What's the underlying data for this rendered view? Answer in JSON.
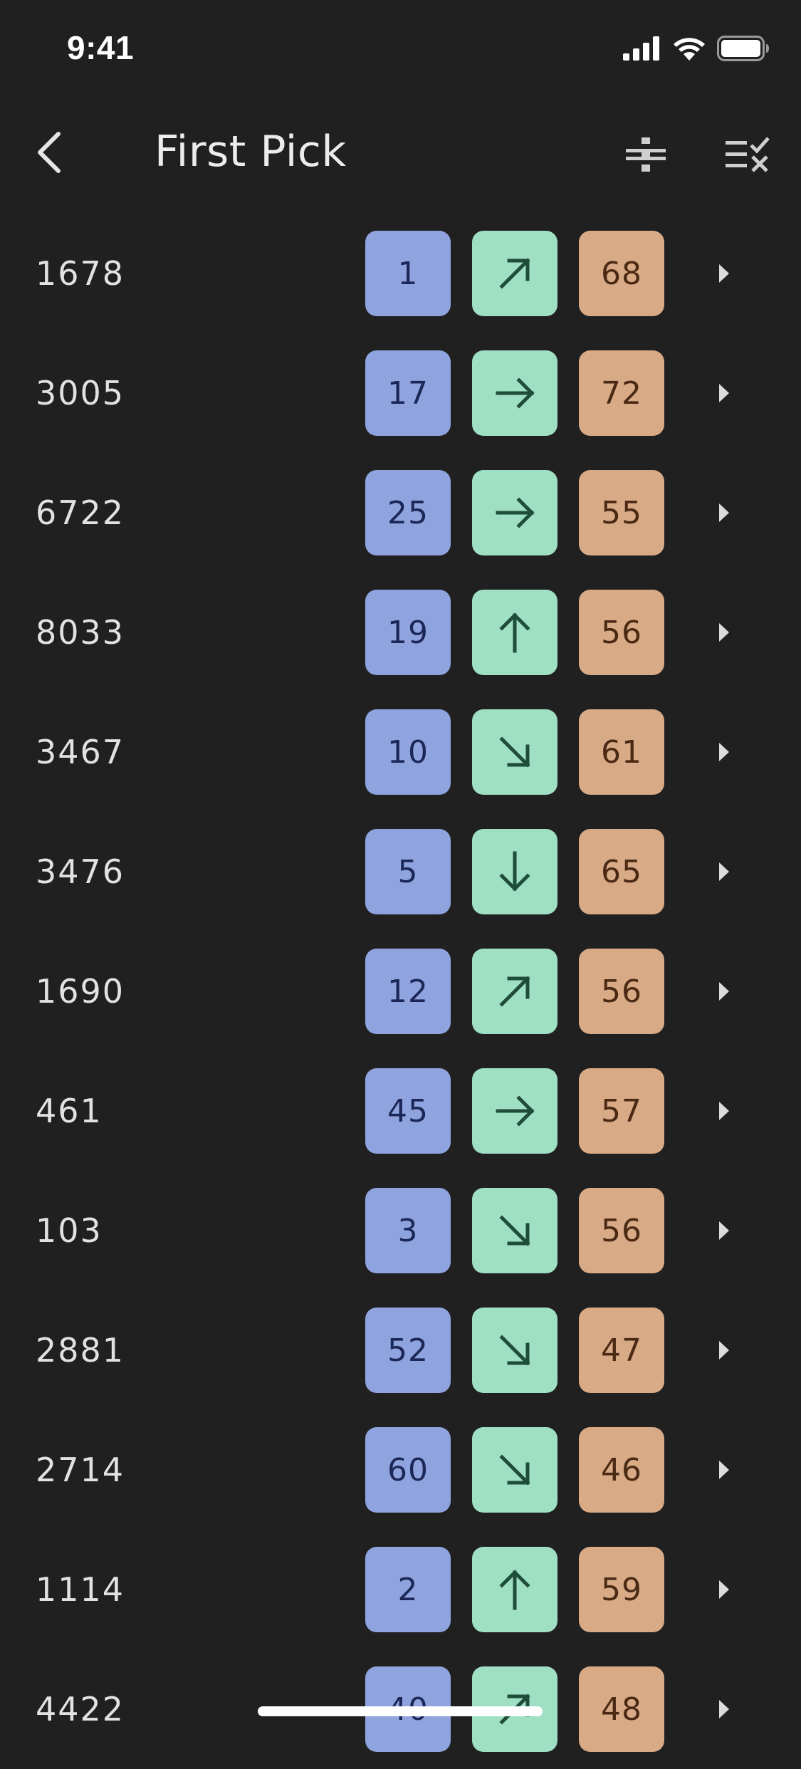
{
  "status_bar": {
    "time": "9:41",
    "icons": [
      "cellular-signal-icon",
      "wifi-icon",
      "battery-icon"
    ]
  },
  "nav": {
    "title": "First Pick",
    "back_icon": "chevron-left-icon",
    "filter_icon": "filter-icon",
    "clear_icon": "list-clear-icon"
  },
  "colors": {
    "background": "#202020",
    "rank_chip": "#8fa4df",
    "trend_chip": "#9fdfc4",
    "score_chip": "#d8aa86"
  },
  "rows": [
    {
      "id": "1678",
      "rank": "1",
      "trend": "up-right",
      "score": "68"
    },
    {
      "id": "3005",
      "rank": "17",
      "trend": "right",
      "score": "72"
    },
    {
      "id": "6722",
      "rank": "25",
      "trend": "right",
      "score": "55"
    },
    {
      "id": "8033",
      "rank": "19",
      "trend": "up",
      "score": "56"
    },
    {
      "id": "3467",
      "rank": "10",
      "trend": "down-right",
      "score": "61"
    },
    {
      "id": "3476",
      "rank": "5",
      "trend": "down",
      "score": "65"
    },
    {
      "id": "1690",
      "rank": "12",
      "trend": "up-right",
      "score": "56"
    },
    {
      "id": "461",
      "rank": "45",
      "trend": "right",
      "score": "57"
    },
    {
      "id": "103",
      "rank": "3",
      "trend": "down-right",
      "score": "56"
    },
    {
      "id": "2881",
      "rank": "52",
      "trend": "down-right",
      "score": "47"
    },
    {
      "id": "2714",
      "rank": "60",
      "trend": "down-right",
      "score": "46"
    },
    {
      "id": "1114",
      "rank": "2",
      "trend": "up",
      "score": "59"
    },
    {
      "id": "4422",
      "rank": "40",
      "trend": "up-right",
      "score": "48"
    }
  ]
}
